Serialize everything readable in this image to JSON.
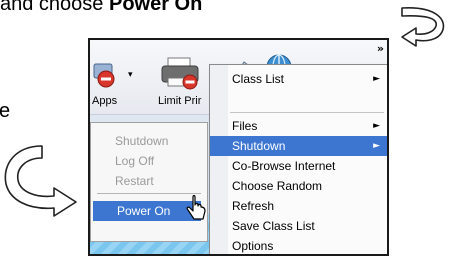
{
  "instruction": {
    "prefix": "and choose ",
    "emphasis": "Power On"
  },
  "edge_letter": "e",
  "toolbar": {
    "apps_label": "Apps",
    "limit_label": "Limit Prir",
    "overflow_chevron": "»"
  },
  "power_submenu": {
    "items": [
      "Shutdown",
      "Log Off",
      "Restart",
      "Power On"
    ]
  },
  "context_menu": {
    "items": [
      {
        "label": "Class List",
        "submenu_arrow": "►"
      },
      {
        "label": "Files",
        "submenu_arrow": "►"
      },
      {
        "label": "Shutdown",
        "submenu_arrow": "►"
      },
      {
        "label": "Co-Browse Internet"
      },
      {
        "label": "Choose Random"
      },
      {
        "label": "Refresh"
      },
      {
        "label": "Save Class List"
      },
      {
        "label": "Options"
      }
    ]
  },
  "colors": {
    "highlight": "#3d76d1",
    "disabled_text": "#9a9a9a",
    "stop_badge": "#d9362b"
  },
  "icons": [
    "curved-arrow-icon",
    "stop-badge-icon",
    "printer-icon",
    "pen-icon",
    "globe-icon",
    "mouse-cursor-icon"
  ]
}
